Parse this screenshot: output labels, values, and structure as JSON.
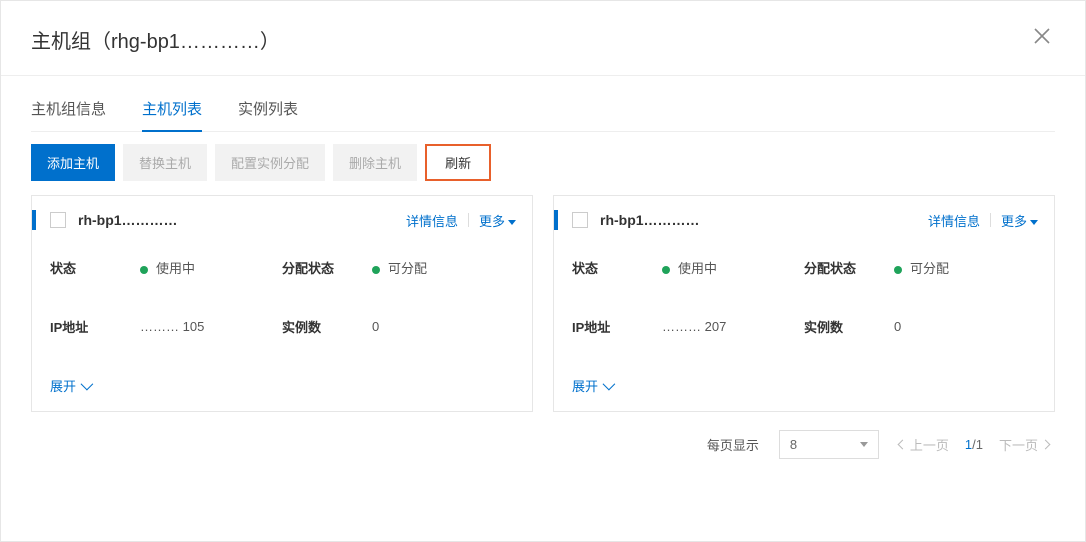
{
  "header": {
    "title": "主机组（rhg-bp1…………）"
  },
  "tabs": [
    {
      "label": "主机组信息"
    },
    {
      "label": "主机列表"
    },
    {
      "label": "实例列表"
    }
  ],
  "active_tab": 1,
  "toolbar": {
    "add": "添加主机",
    "replace": "替换主机",
    "config": "配置实例分配",
    "delete": "删除主机",
    "refresh": "刷新"
  },
  "card_actions": {
    "detail": "详情信息",
    "more": "更多"
  },
  "field_labels": {
    "status": "状态",
    "alloc_status": "分配状态",
    "ip": "IP地址",
    "instance_count": "实例数"
  },
  "status_values": {
    "in_use": "使用中",
    "allocatable": "可分配"
  },
  "expand_label": "展开",
  "hosts": [
    {
      "name": "rh-bp1…………",
      "ip": "……… 105",
      "instance_count": "0"
    },
    {
      "name": "rh-bp1…………",
      "ip": "……… 207",
      "instance_count": "0"
    }
  ],
  "pagination": {
    "page_size_label": "每页显示",
    "page_size": "8",
    "prev": "上一页",
    "next": "下一页",
    "current": "1",
    "total": "/1"
  }
}
